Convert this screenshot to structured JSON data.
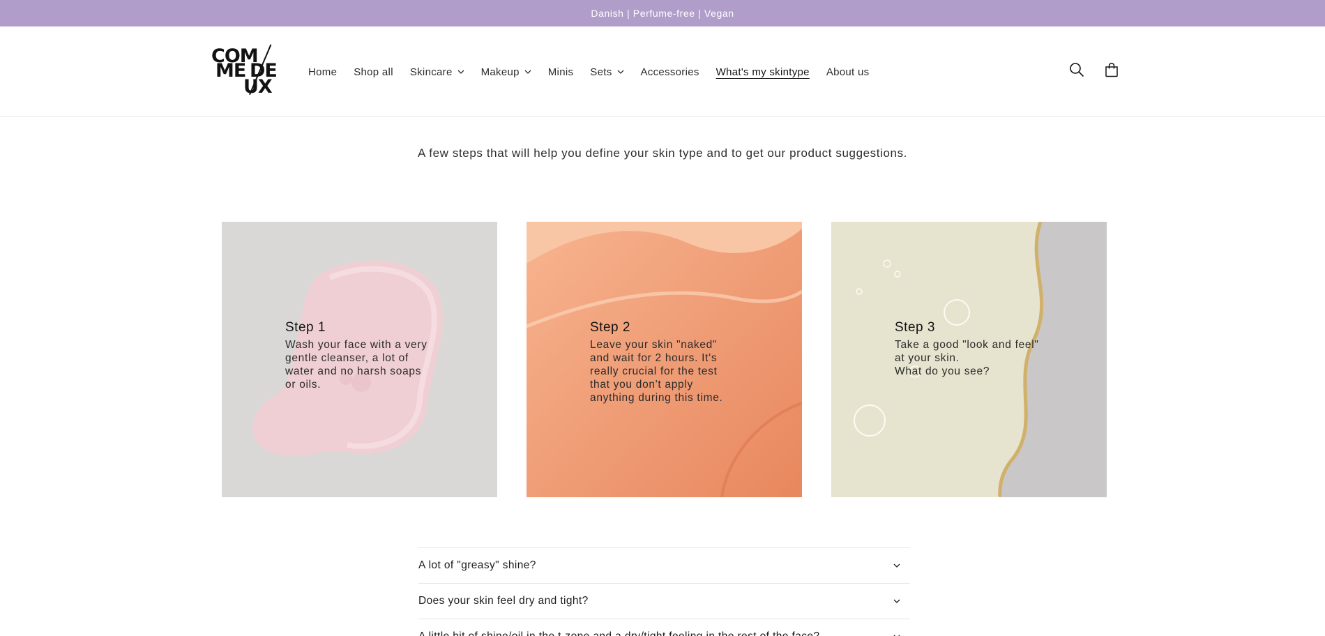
{
  "announcement": "Danish | Perfume-free | Vegan",
  "brand": {
    "line1": "COM",
    "line2": "ME",
    "line3": "DE",
    "line4": "UX",
    "logo_name": "Comme Deux"
  },
  "nav": {
    "items": [
      {
        "label": "Home",
        "dropdown": false,
        "active": false
      },
      {
        "label": "Shop all",
        "dropdown": false,
        "active": false
      },
      {
        "label": "Skincare",
        "dropdown": true,
        "active": false
      },
      {
        "label": "Makeup",
        "dropdown": true,
        "active": false
      },
      {
        "label": "Minis",
        "dropdown": false,
        "active": false
      },
      {
        "label": "Sets",
        "dropdown": true,
        "active": false
      },
      {
        "label": "Accessories",
        "dropdown": false,
        "active": false
      },
      {
        "label": "What's my skintype",
        "dropdown": false,
        "active": true
      },
      {
        "label": "About us",
        "dropdown": false,
        "active": false
      }
    ]
  },
  "header_icons": [
    "search-icon",
    "cart-icon"
  ],
  "intro": "A few steps that will help you define your skin type and to get our product suggestions.",
  "steps": [
    {
      "title": "Step 1",
      "text": "Wash your face with a very\ngentle cleanser, a lot of\nwater and no harsh soaps\nor oils."
    },
    {
      "title": "Step 2",
      "text": "Leave your skin \"naked\"\nand wait for 2 hours. It's\nreally crucial for the test\nthat you don't apply\nanything during this time."
    },
    {
      "title": "Step 3",
      "text": "Take a good \"look and feel\"\nat your skin.\nWhat do you see?"
    }
  ],
  "faq": [
    "A lot of \"greasy\" shine?",
    "Does your skin feel dry and tight?",
    "A little bit of shine/oil in the t-zone and a dry/tight feeling in the rest of the face?"
  ],
  "colors": {
    "announcement_bg": "#b09dca",
    "text": "#121212"
  }
}
